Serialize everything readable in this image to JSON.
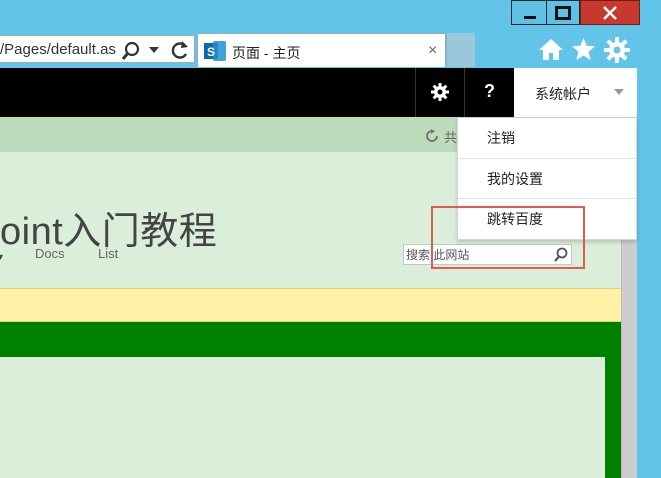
{
  "browser": {
    "address_text": "/Pages/default.as",
    "tab_title": "页面 - 主页",
    "tab_close": "×",
    "favicon_letter": "S",
    "icons": [
      "search-icon",
      "dropdown-arrow-icon",
      "refresh-icon",
      "home-icon",
      "favorites-star-icon",
      "tools-gear-icon"
    ]
  },
  "window_controls": [
    "minimize-icon",
    "maximize-icon",
    "close-icon"
  ],
  "suite_bar": {
    "help_label": "?",
    "account_label": "系统帐户"
  },
  "ribbon": {
    "share_label": "共"
  },
  "site": {
    "title": "oint入门教程",
    "nav_caret": "▾",
    "nav_links": [
      "Docs",
      "List"
    ]
  },
  "search": {
    "placeholder": "搜索 此网站"
  },
  "account_menu": {
    "items": [
      "注销",
      "我的设置",
      "跳转百度"
    ]
  },
  "colors": {
    "chrome_blue": "#62c4e8",
    "close_red": "#c7392c",
    "suite_black": "#000000",
    "page_bg": "#daeeda",
    "ribbon_green": "#bcdcbc",
    "status_yellow": "#fff1a6",
    "band_green": "#008000",
    "highlight_red": "#e05a52"
  }
}
